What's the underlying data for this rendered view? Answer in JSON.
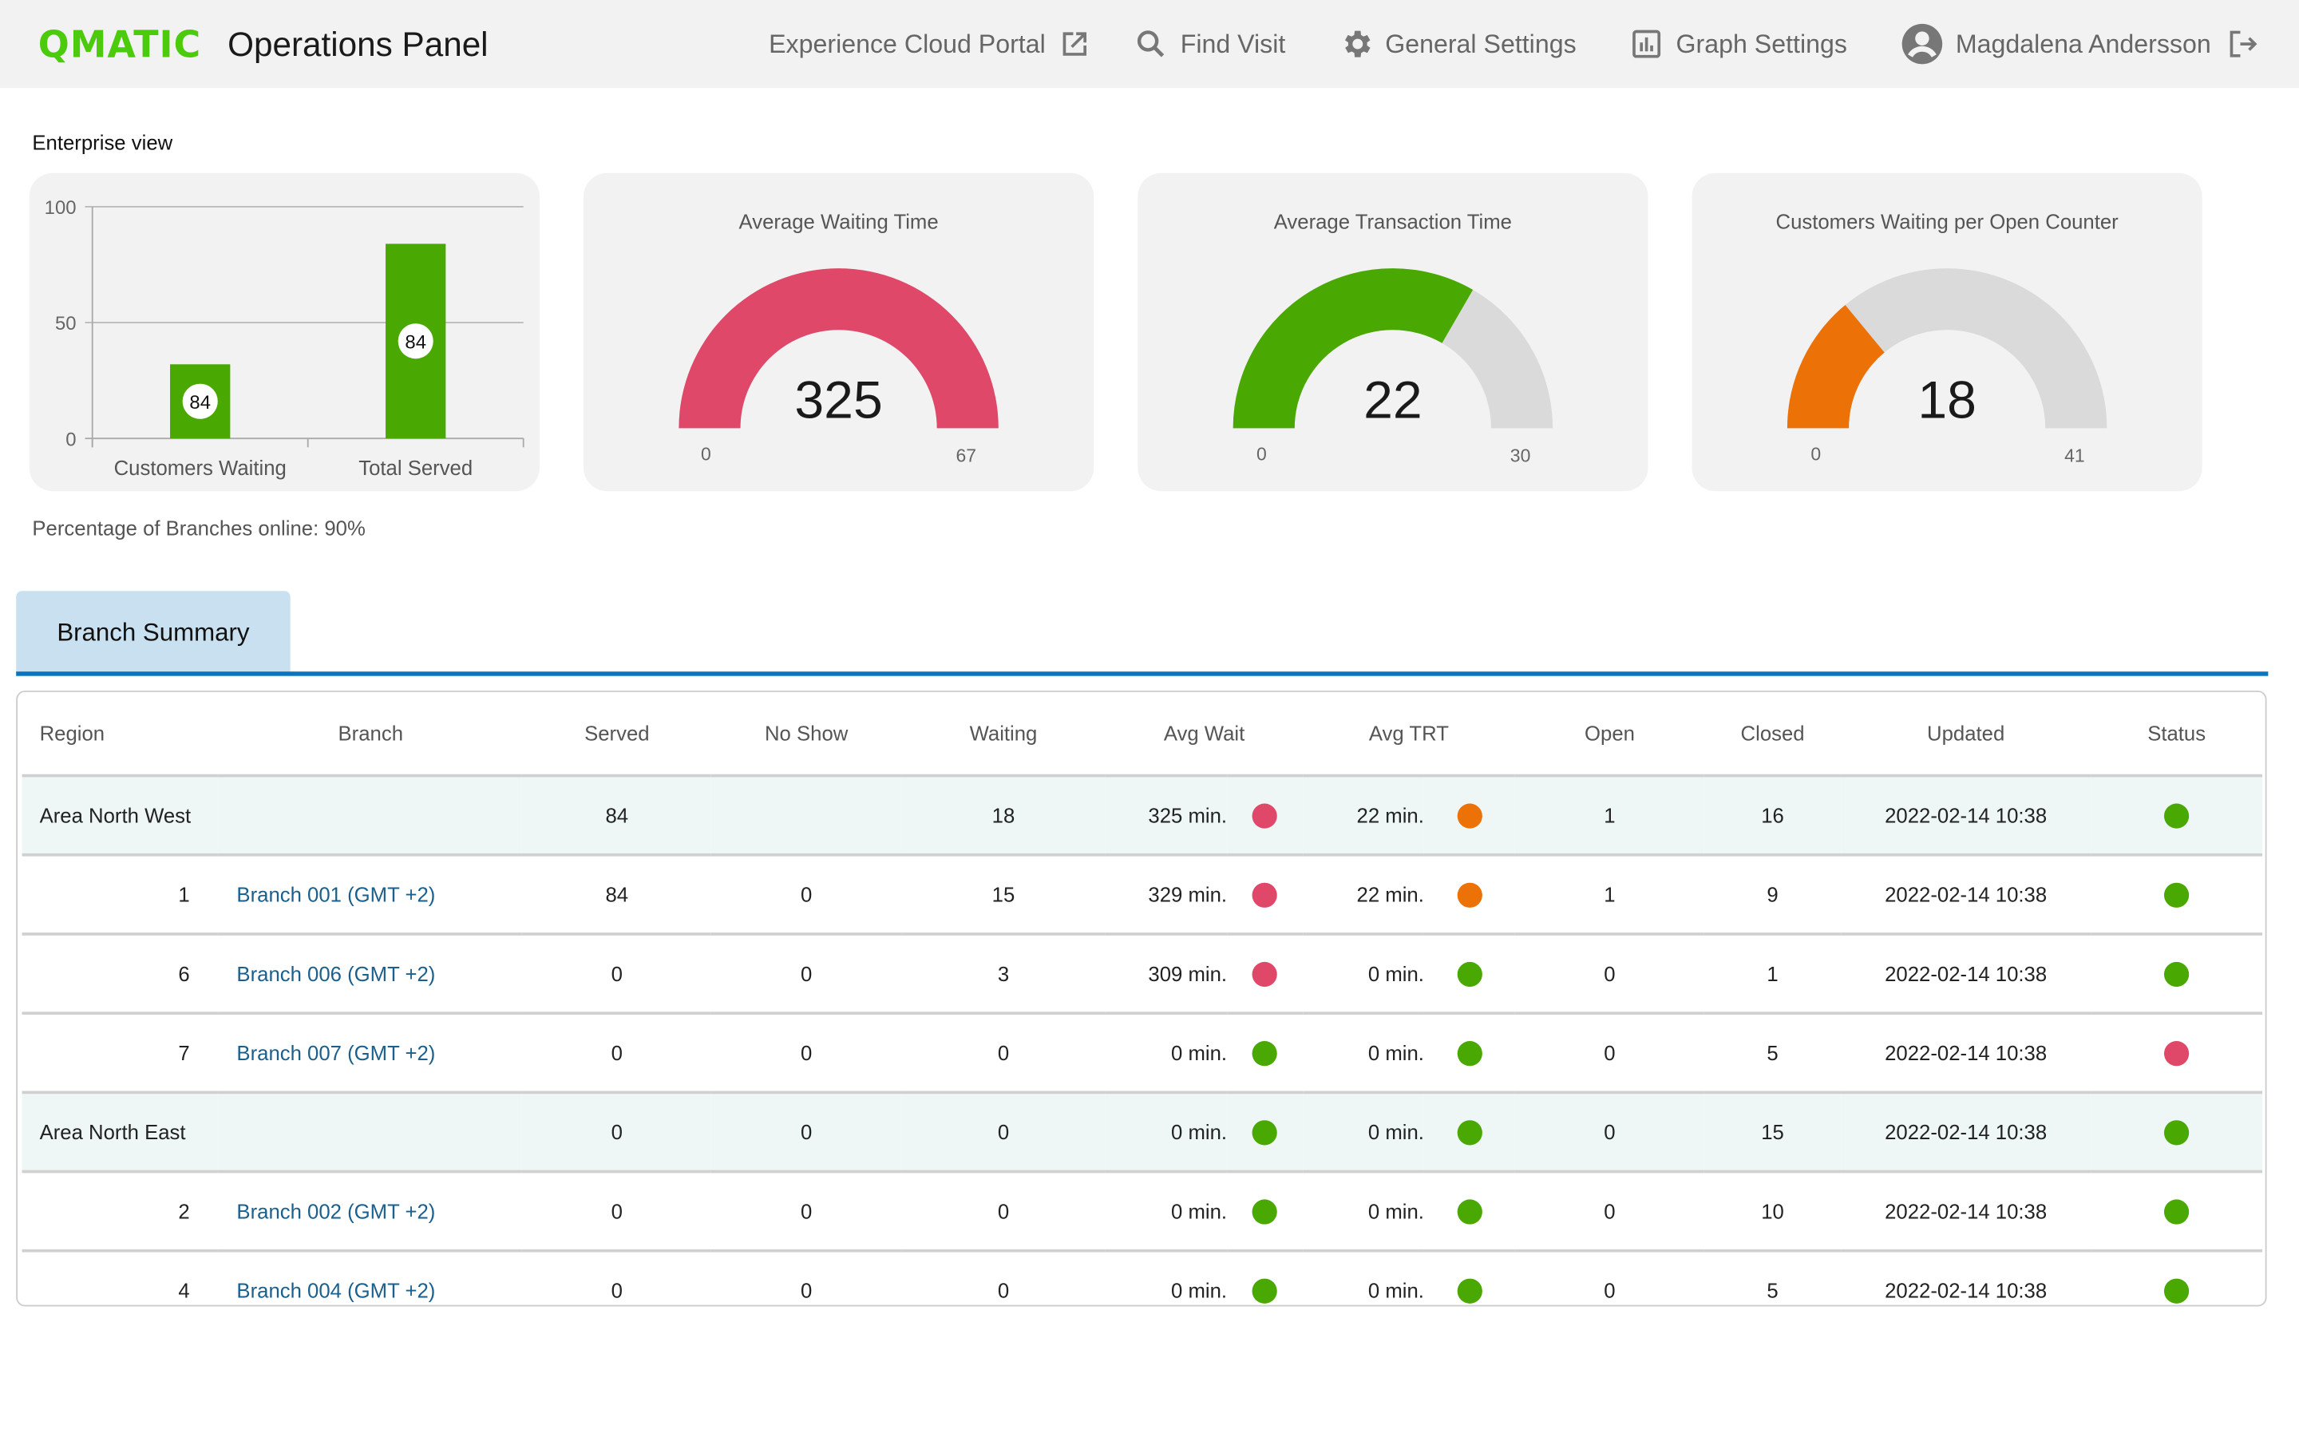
{
  "header": {
    "logo": "QMATIC",
    "title": "Operations Panel",
    "nav": [
      {
        "label": "Experience Cloud Portal",
        "icon": "external-link-icon"
      },
      {
        "label": "Find Visit",
        "icon": "search-icon"
      },
      {
        "label": "General Settings",
        "icon": "gear-icon"
      },
      {
        "label": "Graph Settings",
        "icon": "bar-chart-icon"
      },
      {
        "label": "Magdalena Andersson",
        "icon": "user-avatar-icon"
      }
    ],
    "logout_icon": "logout-icon"
  },
  "enterprise": {
    "title": "Enterprise view",
    "branches_online": "Percentage of Branches online: 90%"
  },
  "colors": {
    "brand_green": "#4ccb0d",
    "green": "#4aa802",
    "red": "#e0486a",
    "orange": "#ec7207",
    "gray_track": "#dadada",
    "tab_active": "#c9e0f0",
    "accent_blue": "#0a74bf",
    "link": "#1b5f8c"
  },
  "chart_data": [
    {
      "type": "bar",
      "title": "",
      "categories": [
        "Customers Waiting",
        "Total Served"
      ],
      "values": [
        32,
        84
      ],
      "data_labels": [
        "84",
        "84"
      ],
      "ylim": [
        0,
        100
      ],
      "yticks": [
        "0",
        "50",
        "100"
      ],
      "grid": true,
      "color": "#4aa802"
    },
    {
      "type": "gauge",
      "title": "Average Waiting Time",
      "value": 325,
      "value_label": "325",
      "min": 0,
      "max": 67,
      "min_label": "0",
      "max_label": "67",
      "fill_fraction": 1.0,
      "color": "#e0486a"
    },
    {
      "type": "gauge",
      "title": "Average Transaction Time",
      "value": 22,
      "value_label": "22",
      "min": 0,
      "max": 30,
      "min_label": "0",
      "max_label": "30",
      "fill_fraction": 0.667,
      "color": "#4aa802"
    },
    {
      "type": "gauge",
      "title": "Customers Waiting per Open Counter",
      "value": 18,
      "value_label": "18",
      "min": 0,
      "max": 41,
      "min_label": "0",
      "max_label": "41",
      "fill_fraction": 0.28,
      "color": "#ec7207"
    }
  ],
  "tabs": [
    {
      "label": "Branch Summary",
      "active": true
    }
  ],
  "table": {
    "columns": [
      "Region",
      "Branch",
      "Served",
      "No Show",
      "Waiting",
      "Avg Wait",
      "Avg TRT",
      "Open",
      "Closed",
      "Updated",
      "Status"
    ],
    "rows": [
      {
        "kind": "region",
        "region": "Area North West",
        "id": "",
        "branch": "",
        "served": "84",
        "no_show": "",
        "waiting": "18",
        "avg_wait": "325 min.",
        "avg_wait_status": "red",
        "avg_trt": "22 min.",
        "avg_trt_status": "orange",
        "open": "1",
        "closed": "16",
        "updated": "2022-02-14 10:38",
        "status": "green"
      },
      {
        "kind": "branch",
        "region": "",
        "id": "1",
        "branch": "Branch 001 (GMT +2)",
        "served": "84",
        "no_show": "0",
        "waiting": "15",
        "avg_wait": "329 min.",
        "avg_wait_status": "red",
        "avg_trt": "22 min.",
        "avg_trt_status": "orange",
        "open": "1",
        "closed": "9",
        "updated": "2022-02-14 10:38",
        "status": "green"
      },
      {
        "kind": "branch",
        "region": "",
        "id": "6",
        "branch": "Branch 006 (GMT +2)",
        "served": "0",
        "no_show": "0",
        "waiting": "3",
        "avg_wait": "309 min.",
        "avg_wait_status": "red",
        "avg_trt": "0 min.",
        "avg_trt_status": "green",
        "open": "0",
        "closed": "1",
        "updated": "2022-02-14 10:38",
        "status": "green"
      },
      {
        "kind": "branch",
        "region": "",
        "id": "7",
        "branch": "Branch 007 (GMT +2)",
        "served": "0",
        "no_show": "0",
        "waiting": "0",
        "avg_wait": "0 min.",
        "avg_wait_status": "green",
        "avg_trt": "0 min.",
        "avg_trt_status": "green",
        "open": "0",
        "closed": "5",
        "updated": "2022-02-14 10:38",
        "status": "red"
      },
      {
        "kind": "region",
        "region": "Area North East",
        "id": "",
        "branch": "",
        "served": "0",
        "no_show": "0",
        "waiting": "0",
        "avg_wait": "0 min.",
        "avg_wait_status": "green",
        "avg_trt": "0 min.",
        "avg_trt_status": "green",
        "open": "0",
        "closed": "15",
        "updated": "2022-02-14 10:38",
        "status": "green"
      },
      {
        "kind": "branch",
        "region": "",
        "id": "2",
        "branch": "Branch 002 (GMT +2)",
        "served": "0",
        "no_show": "0",
        "waiting": "0",
        "avg_wait": "0 min.",
        "avg_wait_status": "green",
        "avg_trt": "0 min.",
        "avg_trt_status": "green",
        "open": "0",
        "closed": "10",
        "updated": "2022-02-14 10:38",
        "status": "green"
      },
      {
        "kind": "branch",
        "region": "",
        "id": "4",
        "branch": "Branch 004 (GMT +2)",
        "served": "0",
        "no_show": "0",
        "waiting": "0",
        "avg_wait": "0 min.",
        "avg_wait_status": "green",
        "avg_trt": "0 min.",
        "avg_trt_status": "green",
        "open": "0",
        "closed": "5",
        "updated": "2022-02-14 10:38",
        "status": "green"
      }
    ]
  }
}
